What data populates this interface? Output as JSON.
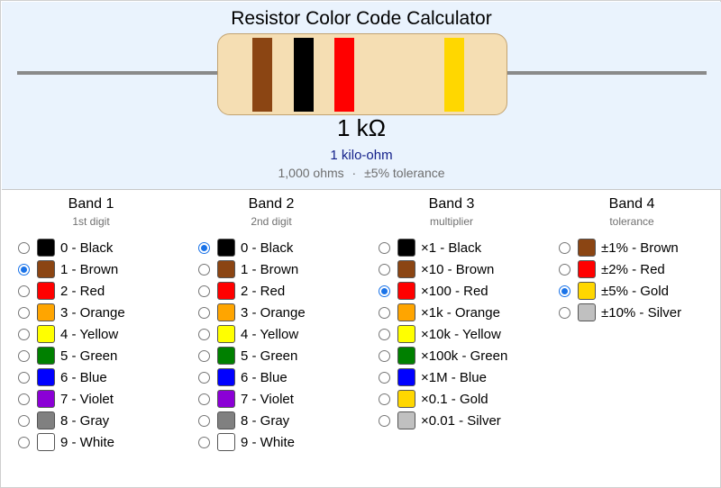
{
  "title": "Resistor Color Code Calculator",
  "result": {
    "value": "1 kΩ",
    "words": "1 kilo-ohm",
    "ohms": "1,000 ohms",
    "separator": "·",
    "tolerance": "±5% tolerance"
  },
  "resistor_bands": [
    {
      "color": "#8b4513"
    },
    {
      "color": "#000000"
    },
    {
      "color": "#ff0000"
    },
    {
      "color": "#ffd700"
    }
  ],
  "columns": [
    {
      "title": "Band 1",
      "subtitle": "1st digit",
      "selected": 1,
      "options": [
        {
          "label": "0 - Black",
          "color": "#000000"
        },
        {
          "label": "1 - Brown",
          "color": "#8b4513"
        },
        {
          "label": "2 - Red",
          "color": "#ff0000"
        },
        {
          "label": "3 - Orange",
          "color": "#ffa500"
        },
        {
          "label": "4 - Yellow",
          "color": "#ffff00"
        },
        {
          "label": "5 - Green",
          "color": "#008000"
        },
        {
          "label": "6 - Blue",
          "color": "#0000ff"
        },
        {
          "label": "7 - Violet",
          "color": "#8b00d6"
        },
        {
          "label": "8 - Gray",
          "color": "#808080"
        },
        {
          "label": "9 - White",
          "color": "#ffffff"
        }
      ]
    },
    {
      "title": "Band 2",
      "subtitle": "2nd digit",
      "selected": 0,
      "options": [
        {
          "label": "0 - Black",
          "color": "#000000"
        },
        {
          "label": "1 - Brown",
          "color": "#8b4513"
        },
        {
          "label": "2 - Red",
          "color": "#ff0000"
        },
        {
          "label": "3 - Orange",
          "color": "#ffa500"
        },
        {
          "label": "4 - Yellow",
          "color": "#ffff00"
        },
        {
          "label": "5 - Green",
          "color": "#008000"
        },
        {
          "label": "6 - Blue",
          "color": "#0000ff"
        },
        {
          "label": "7 - Violet",
          "color": "#8b00d6"
        },
        {
          "label": "8 - Gray",
          "color": "#808080"
        },
        {
          "label": "9 - White",
          "color": "#ffffff"
        }
      ]
    },
    {
      "title": "Band 3",
      "subtitle": "multiplier",
      "selected": 2,
      "options": [
        {
          "label": "×1 - Black",
          "color": "#000000"
        },
        {
          "label": "×10 - Brown",
          "color": "#8b4513"
        },
        {
          "label": "×100 - Red",
          "color": "#ff0000"
        },
        {
          "label": "×1k - Orange",
          "color": "#ffa500"
        },
        {
          "label": "×10k - Yellow",
          "color": "#ffff00"
        },
        {
          "label": "×100k - Green",
          "color": "#008000"
        },
        {
          "label": "×1M - Blue",
          "color": "#0000ff"
        },
        {
          "label": "×0.1 - Gold",
          "color": "#ffd700"
        },
        {
          "label": "×0.01 - Silver",
          "color": "#c0c0c0"
        }
      ]
    },
    {
      "title": "Band 4",
      "subtitle": "tolerance",
      "selected": 2,
      "options": [
        {
          "label": "±1% - Brown",
          "color": "#8b4513"
        },
        {
          "label": "±2% - Red",
          "color": "#ff0000"
        },
        {
          "label": "±5% - Gold",
          "color": "#ffd700"
        },
        {
          "label": "±10% - Silver",
          "color": "#c0c0c0"
        }
      ]
    }
  ]
}
